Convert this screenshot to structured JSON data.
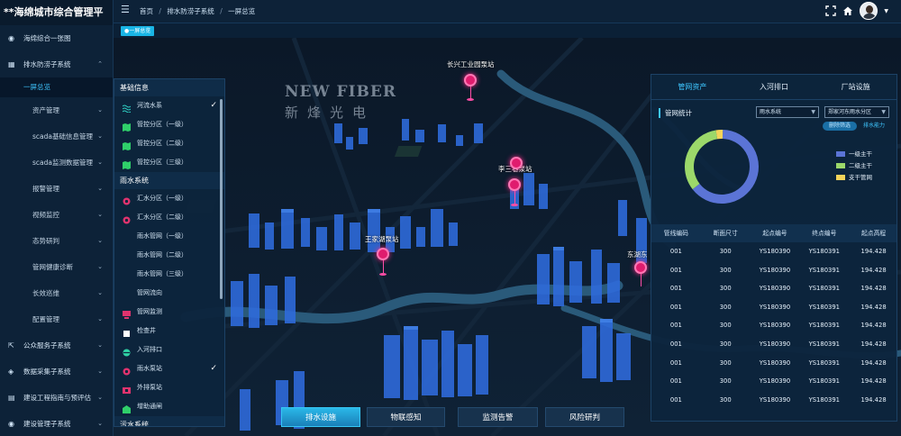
{
  "app": {
    "title": "**海绵城市综合管理平"
  },
  "sidebar": {
    "items": [
      {
        "label": "海绵综合一张图",
        "icon": "globe-icon",
        "chevron": false
      },
      {
        "label": "排水防涝子系统",
        "icon": "grid-icon",
        "chevron": true
      },
      {
        "label": "一屏总览",
        "active": true
      },
      {
        "label": "资产管理",
        "sub": true
      },
      {
        "label": "scada基础信息管理",
        "sub": true
      },
      {
        "label": "scada监测数据管理",
        "sub": true
      },
      {
        "label": "报警管理",
        "sub": true
      },
      {
        "label": "视频监控",
        "sub": true
      },
      {
        "label": "态势研判",
        "sub": true
      },
      {
        "label": "管网健康诊断",
        "sub": true
      },
      {
        "label": "长效巡维",
        "sub": true
      },
      {
        "label": "配置管理",
        "sub": true
      },
      {
        "label": "公众服务子系统",
        "icon": "external-icon",
        "chevron": true
      },
      {
        "label": "数据采集子系统",
        "icon": "layers-icon",
        "chevron": true
      },
      {
        "label": "建设工程指南与预评估",
        "icon": "document-icon",
        "chevron": true
      },
      {
        "label": "建设管理子系统",
        "icon": "globe-icon",
        "chevron": true
      }
    ]
  },
  "topbar": {
    "breadcrumb": [
      "首页",
      "排水防涝子系统",
      "一屏总览"
    ],
    "icons": [
      "fullscreen-icon",
      "home-icon"
    ]
  },
  "tabstrip": {
    "active_tag": "●一屏总览"
  },
  "watermark": {
    "brand_en": "NEW FIBER",
    "brand_cn": "新烽光电"
  },
  "map": {
    "stations": [
      {
        "label": "长兴工业园泵站"
      },
      {
        "label": "李三巷泵站"
      },
      {
        "label": "王家湖泵站"
      },
      {
        "label": "东湖东"
      }
    ]
  },
  "layer_panel": {
    "sections": [
      {
        "title": "基础信息",
        "items": [
          {
            "label": "河流水系",
            "icon": "river-icon",
            "color": "#2fd3c7",
            "checked": true
          },
          {
            "label": "管控分区（一级）",
            "icon": "map-icon",
            "color": "#2fcf6a",
            "checked": false
          },
          {
            "label": "管控分区（二级）",
            "icon": "map-icon",
            "color": "#2fcf6a",
            "checked": false
          },
          {
            "label": "管控分区（三级）",
            "icon": "map-icon",
            "color": "#2fcf6a",
            "checked": false
          }
        ]
      },
      {
        "title": "雨水系统",
        "items": [
          {
            "label": "汇水分区（一级）",
            "icon": "zone-icon",
            "color": "#e0336e",
            "checked": false
          },
          {
            "label": "汇水分区（二级）",
            "icon": "zone-icon",
            "color": "#e0336e",
            "checked": false
          },
          {
            "label": "雨水管网（一级）",
            "icon": "line-icon",
            "color": "#1b5fd1",
            "checked": false
          },
          {
            "label": "雨水管网（二级）",
            "icon": "line-icon",
            "color": "#1b5fd1",
            "checked": false
          },
          {
            "label": "雨水管网（三级）",
            "icon": "line-icon",
            "color": "#1b5fd1",
            "checked": false
          },
          {
            "label": "管网流向",
            "icon": "flow-icon",
            "color": "#1b5fd1",
            "checked": false
          },
          {
            "label": "管网监测",
            "icon": "monitor-icon",
            "color": "#e0336e",
            "checked": false
          },
          {
            "label": "检查井",
            "icon": "well-icon",
            "color": "#ffffff",
            "checked": false
          },
          {
            "label": "入河排口",
            "icon": "outlet-icon",
            "color": "#2fd3a5",
            "checked": false
          },
          {
            "label": "雨水泵站",
            "icon": "pump-icon",
            "color": "#e0336e",
            "checked": true
          },
          {
            "label": "外排泵站",
            "icon": "pump-out-icon",
            "color": "#e0336e",
            "checked": false
          },
          {
            "label": "增助通闸",
            "icon": "gate-icon",
            "color": "#2fcf6a",
            "checked": false
          }
        ]
      },
      {
        "title": "污水系统",
        "items": []
      }
    ]
  },
  "bottom_tabs": [
    {
      "label": "排水设施",
      "active": true
    },
    {
      "label": "物联感知",
      "active": false
    },
    {
      "label": "监测告警",
      "active": false
    },
    {
      "label": "风险研判",
      "active": false
    }
  ],
  "right_panel": {
    "tabs": [
      {
        "label": "管网资产",
        "active": true
      },
      {
        "label": "入河排口",
        "active": false
      },
      {
        "label": "厂站设施",
        "active": false
      }
    ],
    "stats_label": "管网统计",
    "select_system": "雨水系统",
    "select_area": "郑家河东雨水分区",
    "switch_on": "删除筛选",
    "switch_off": "排水能力",
    "legend": [
      {
        "label": "一级主干",
        "color": "#5b74d6"
      },
      {
        "label": "二级主干",
        "color": "#9cd86a"
      },
      {
        "label": "支干管网",
        "color": "#f5d45a"
      }
    ],
    "table": {
      "headers": [
        "管线编码",
        "断面尺寸",
        "起点编号",
        "终点编号",
        "起点高程"
      ],
      "rows": [
        [
          "001",
          "300",
          "YS180390",
          "YS180391",
          "194.428"
        ],
        [
          "001",
          "300",
          "YS180390",
          "YS180391",
          "194.428"
        ],
        [
          "001",
          "300",
          "YS180390",
          "YS180391",
          "194.428"
        ],
        [
          "001",
          "300",
          "YS180390",
          "YS180391",
          "194.428"
        ],
        [
          "001",
          "300",
          "YS180390",
          "YS180391",
          "194.428"
        ],
        [
          "001",
          "300",
          "YS180390",
          "YS180391",
          "194.428"
        ],
        [
          "001",
          "300",
          "YS180390",
          "YS180391",
          "194.428"
        ],
        [
          "001",
          "300",
          "YS180390",
          "YS180391",
          "194.428"
        ],
        [
          "001",
          "300",
          "YS180390",
          "YS180391",
          "194.428"
        ]
      ]
    }
  },
  "chart_data": {
    "type": "pie",
    "categories": [
      "一级主干",
      "二级主干",
      "支干管网"
    ],
    "values": [
      64,
      33,
      3
    ],
    "colors": [
      "#5b74d6",
      "#9cd86a",
      "#f5d45a"
    ]
  }
}
